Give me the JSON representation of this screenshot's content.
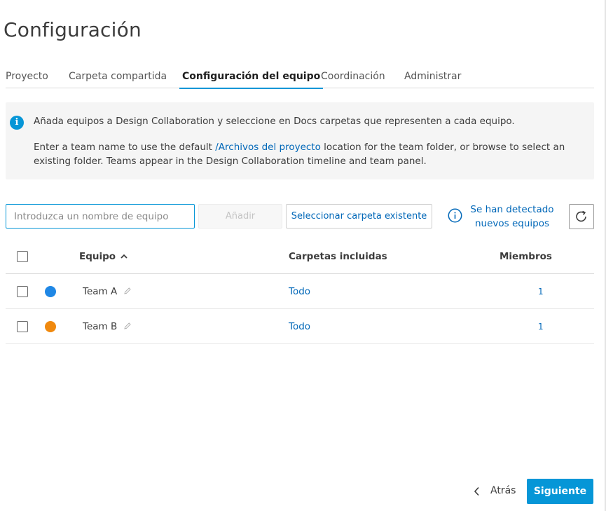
{
  "page": {
    "title": "Configuración"
  },
  "tabs": [
    {
      "label": "Proyecto"
    },
    {
      "label": "Carpeta compartida"
    },
    {
      "label": "Configuración del equipo",
      "active": true
    },
    {
      "label": "Coordinación"
    },
    {
      "label": "Administrar"
    }
  ],
  "info": {
    "line1": "Añada equipos a Design Collaboration y seleccione en Docs carpetas que representen a cada equipo.",
    "line2_before": "Enter a team name to use the default ",
    "line2_link": "/Archivos del proyecto",
    "line2_after": " location for the team folder, or browse to select an existing folder. Teams appear in the Design Collaboration timeline and team panel."
  },
  "toolbar": {
    "input_placeholder": "Introduzca un nombre de equipo",
    "input_value": "",
    "add_label": "Añadir",
    "select_folder_label": "Seleccionar carpeta existente",
    "detected_line1": "Se han detectado",
    "detected_line2": "nuevos equipos"
  },
  "table": {
    "headers": {
      "team": "Equipo",
      "folders": "Carpetas incluidas",
      "members": "Miembros"
    },
    "rows": [
      {
        "name": "Team A",
        "color": "#1f87e5",
        "folders": "Todo",
        "members": "1"
      },
      {
        "name": "Team B",
        "color": "#f0890e",
        "folders": "Todo",
        "members": "1"
      }
    ]
  },
  "footer": {
    "back_label": "Atrás",
    "next_label": "Siguiente"
  },
  "colors": {
    "accent": "#0696d7",
    "link": "#0067b8"
  },
  "icons": [
    "info-icon",
    "refresh-icon",
    "sort-up-icon",
    "pencil-icon",
    "chevron-left-icon"
  ]
}
